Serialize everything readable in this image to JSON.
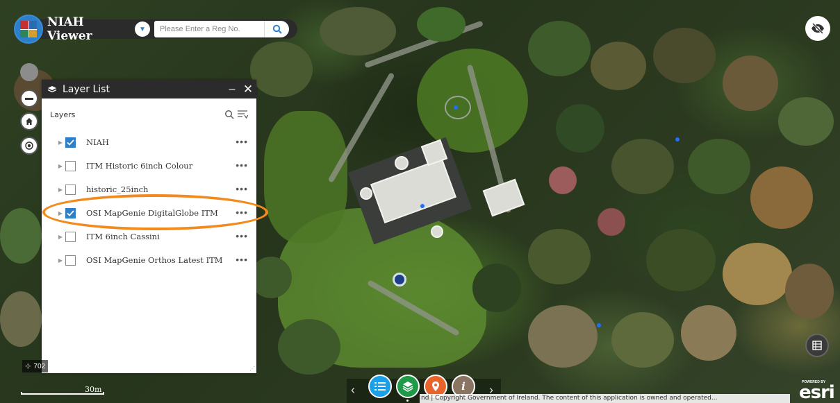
{
  "header": {
    "app_title": "NIAH Viewer",
    "search_placeholder": "Please Enter a Reg No.",
    "logo_icon": "niah-logo"
  },
  "map_tools": [
    "zoom-slider-icon",
    "zoom-out-icon",
    "home-icon",
    "locate-icon"
  ],
  "layer_panel": {
    "title": "Layer List",
    "minimize": "–",
    "close": "✕",
    "layers_label": "Layers",
    "layers": [
      {
        "name": "NIAH",
        "checked": true
      },
      {
        "name": "ITM Historic 6inch Colour",
        "checked": false
      },
      {
        "name": "historic_25inch",
        "checked": false
      },
      {
        "name": "OSI MapGenie DigitalGlobe ITM",
        "checked": true,
        "highlighted": true
      },
      {
        "name": "ITM 6inch Cassini",
        "checked": false
      },
      {
        "name": "OSI MapGenie Orthos Latest ITM",
        "checked": false
      }
    ],
    "more_label": "•••"
  },
  "coords": {
    "value": "702"
  },
  "scale": {
    "label": "30m"
  },
  "dock": {
    "items": [
      {
        "icon": "list-icon",
        "color": "#1aa0e8"
      },
      {
        "icon": "layers-icon",
        "color": "#1e9a48"
      },
      {
        "icon": "map-pin-icon",
        "color": "#e8642a"
      },
      {
        "icon": "info-icon",
        "color": "#8a7563"
      }
    ]
  },
  "attribution": "nd | Copyright Government of Ireland. The content of this application is owned and operated...",
  "esri": {
    "powered": "POWERED BY",
    "word": "esri"
  },
  "colors": {
    "accent": "#2e7fc9",
    "highlight": "#f28a1e",
    "panel_header": "#2b2b2b"
  }
}
